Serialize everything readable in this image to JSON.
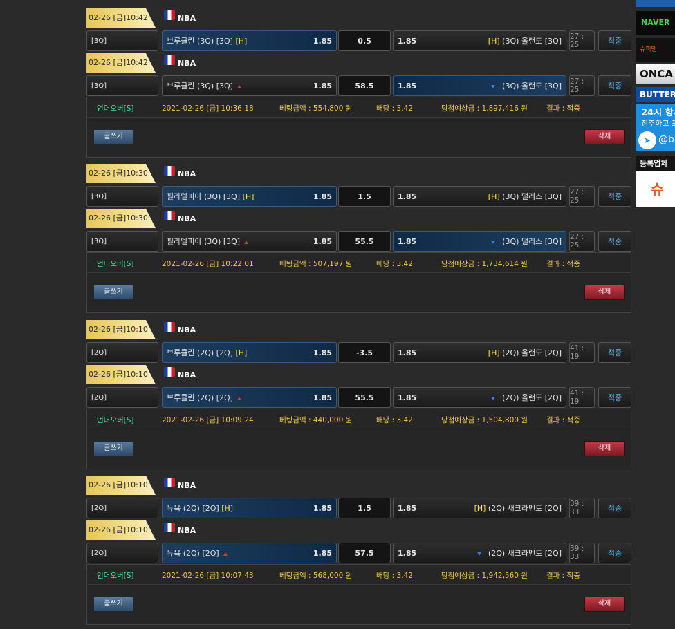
{
  "league_name": "NBA",
  "write_label": "글쓰기",
  "delete_label": "삭제",
  "bets": [
    {
      "rows": [
        {
          "date": "02-26 [금]10:42",
          "period": "[3Q]",
          "home": "브루클린 (3Q) [3Q]",
          "home_h": "[H]",
          "home_odds": "1.85",
          "line": "0.5",
          "away_odds": "1.85",
          "away_h": "[H]",
          "away": "(3Q) 올랜도 [3Q]",
          "time": "27 : 25",
          "result": "적중",
          "selected": "home",
          "arrow": ""
        },
        {
          "date": "02-26 [금]10:42",
          "period": "[3Q]",
          "home": "브루클린 (3Q) [3Q]",
          "home_h": "",
          "home_odds": "1.85",
          "line": "58.5",
          "away_odds": "1.85",
          "away_h": "",
          "away": "(3Q) 올랜도 [3Q]",
          "time": "27 : 25",
          "result": "적중",
          "selected": "away",
          "arrow": "updown"
        }
      ],
      "summary": {
        "type": "언더오버[S]",
        "datetime": "2021-02-26 [금] 10:36:18",
        "amount": "베팅금액 : 554,800 원",
        "dividend": "배당 : 3.42",
        "expected": "당첨예상금 : 1,897,416 원",
        "result": "결과 : 적중"
      }
    },
    {
      "rows": [
        {
          "date": "02-26 [금]10:30",
          "period": "[3Q]",
          "home": "필라델피아 (3Q) [3Q]",
          "home_h": "[H]",
          "home_odds": "1.85",
          "line": "1.5",
          "away_odds": "1.85",
          "away_h": "[H]",
          "away": "(3Q) 댈러스 [3Q]",
          "time": "27 : 25",
          "result": "적중",
          "selected": "home",
          "arrow": ""
        },
        {
          "date": "02-26 [금]10:30",
          "period": "[3Q]",
          "home": "필라델피아 (3Q) [3Q]",
          "home_h": "",
          "home_odds": "1.85",
          "line": "55.5",
          "away_odds": "1.85",
          "away_h": "",
          "away": "(3Q) 댈러스 [3Q]",
          "time": "27 : 25",
          "result": "적중",
          "selected": "away",
          "arrow": "updown"
        }
      ],
      "summary": {
        "type": "언더오버[S]",
        "datetime": "2021-02-26 [금] 10:22:01",
        "amount": "베팅금액 : 507,197 원",
        "dividend": "배당 : 3.42",
        "expected": "당첨예상금 : 1,734,614 원",
        "result": "결과 : 적중"
      }
    },
    {
      "rows": [
        {
          "date": "02-26 [금]10:10",
          "period": "[2Q]",
          "home": "브루클린 (2Q) [2Q]",
          "home_h": "[H]",
          "home_odds": "1.85",
          "line": "-3.5",
          "away_odds": "1.85",
          "away_h": "[H]",
          "away": "(2Q) 올랜도 [2Q]",
          "time": "41 : 19",
          "result": "적중",
          "selected": "home",
          "arrow": ""
        },
        {
          "date": "02-26 [금]10:10",
          "period": "[2Q]",
          "home": "브루클린 (2Q) [2Q]",
          "home_h": "",
          "home_odds": "1.85",
          "line": "55.5",
          "away_odds": "1.85",
          "away_h": "",
          "away": "(2Q) 올랜도 [2Q]",
          "time": "41 : 19",
          "result": "적중",
          "selected": "home",
          "arrow": "updown"
        }
      ],
      "summary": {
        "type": "언더오버[S]",
        "datetime": "2021-02-26 [금] 10:09:24",
        "amount": "베팅금액 : 440,000 원",
        "dividend": "배당 : 3.42",
        "expected": "당첨예상금 : 1,504,800 원",
        "result": "결과 : 적중"
      }
    },
    {
      "rows": [
        {
          "date": "02-26 [금]10:10",
          "period": "[2Q]",
          "home": "뉴욕 (2Q) [2Q]",
          "home_h": "[H]",
          "home_odds": "1.85",
          "line": "1.5",
          "away_odds": "1.85",
          "away_h": "[H]",
          "away": "(2Q) 새크라멘토 [2Q]",
          "time": "39 : 33",
          "result": "적중",
          "selected": "home",
          "arrow": ""
        },
        {
          "date": "02-26 [금]10:10",
          "period": "[2Q]",
          "home": "뉴욕 (2Q) [2Q]",
          "home_h": "",
          "home_odds": "1.85",
          "line": "57.5",
          "away_odds": "1.85",
          "away_h": "",
          "away": "(2Q) 새크라멘토 [2Q]",
          "time": "39 : 33",
          "result": "적중",
          "selected": "home",
          "arrow": "updown"
        }
      ],
      "summary": {
        "type": "언더오버[S]",
        "datetime": "2021-02-26 [금] 10:07:43",
        "amount": "베팅금액 : 568,000 원",
        "dividend": "배당 : 3.42",
        "expected": "당첨예상금 : 1,942,560 원",
        "result": "결과 : 적중"
      }
    }
  ],
  "sidebar_ads": {
    "naver": "NAVER",
    "logo2": "슈퍼맨",
    "onca": "ONCA",
    "butter": "BUTTER",
    "promo_line1": "24시 항시",
    "promo_line2": "친추하고 포",
    "promo_handle": "@b",
    "register": "등록업체",
    "register_logo": "슈"
  }
}
